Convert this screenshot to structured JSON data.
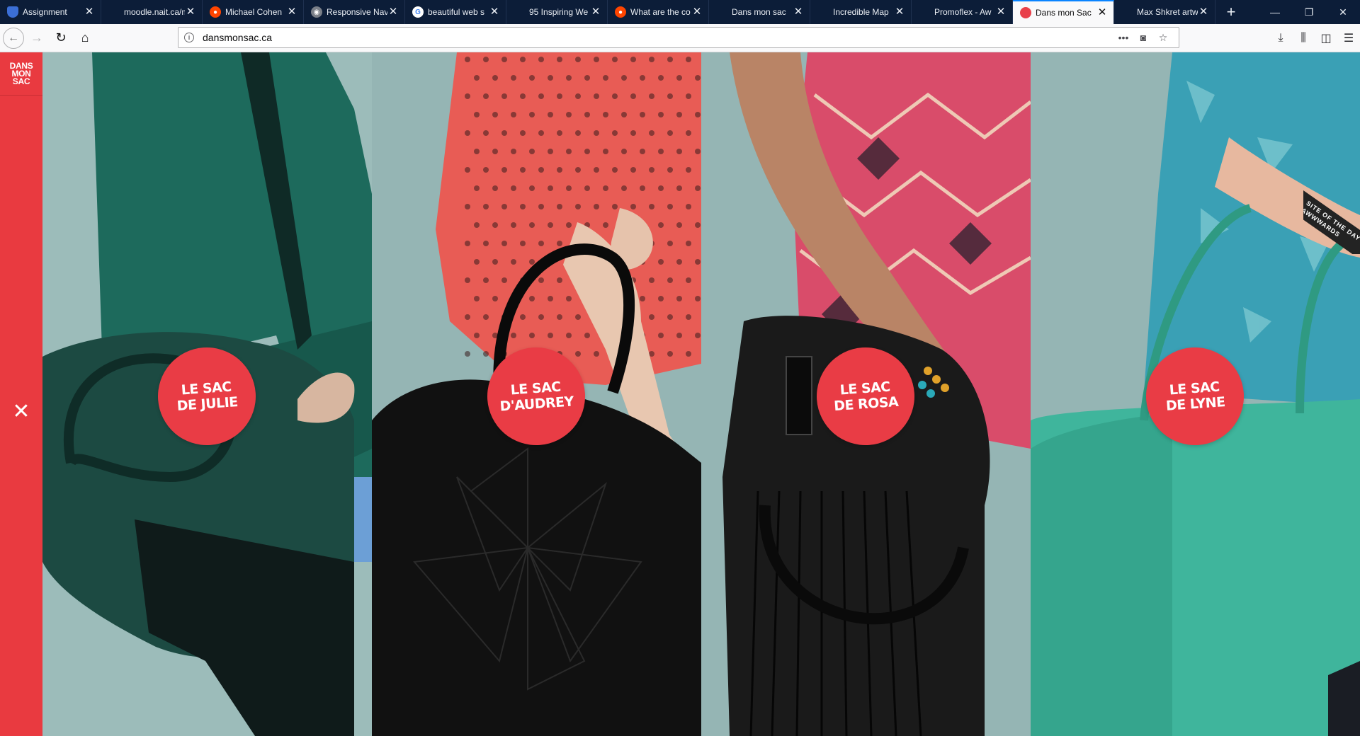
{
  "browser": {
    "tabs": [
      {
        "title": "Assignment",
        "favicon": "shield-icon",
        "fav_class": "shield",
        "active": false
      },
      {
        "title": "moodle.nait.ca/mo",
        "favicon": "none",
        "fav_class": "none",
        "active": false
      },
      {
        "title": "Michael Cohen",
        "favicon": "reddit-icon",
        "fav_class": "reddit",
        "active": false
      },
      {
        "title": "Responsive Nav",
        "favicon": "owl-icon",
        "fav_class": "owl",
        "active": false
      },
      {
        "title": "beautiful web s",
        "favicon": "google-icon",
        "fav_class": "google",
        "active": false
      },
      {
        "title": "95 Inspiring We",
        "favicon": "none",
        "fav_class": "none",
        "active": false
      },
      {
        "title": "What are the co",
        "favicon": "reddit-icon",
        "fav_class": "reddit",
        "active": false
      },
      {
        "title": "Dans mon sac",
        "favicon": "none",
        "fav_class": "none",
        "active": false
      },
      {
        "title": "Incredible Map",
        "favicon": "none",
        "fav_class": "none",
        "active": false
      },
      {
        "title": "Promoflex - Aw",
        "favicon": "none",
        "fav_class": "none",
        "active": false
      },
      {
        "title": "Dans mon Sac",
        "favicon": "bag-icon",
        "fav_class": "pink",
        "active": true
      },
      {
        "title": "Max Shkret artw",
        "favicon": "none",
        "fav_class": "none",
        "active": false
      }
    ],
    "url": "dansmonsac.ca"
  },
  "site": {
    "logo_lines": [
      "DANS",
      "MON",
      "SAC"
    ],
    "close_glyph": "✕",
    "accent": "#e93a40",
    "background": "#95b5b4",
    "ribbon": {
      "line1": "SITE OF THE DAY",
      "line2": "AWWWARDS"
    },
    "panels": [
      {
        "badge_line1": "LE SAC",
        "badge_line2": "DE JULIE",
        "top_color": "#1d6a5c",
        "bag_color": "#1c4a42"
      },
      {
        "badge_line1": "LE SAC",
        "badge_line2": "D'AUDREY",
        "top_color": "#e85c55",
        "bag_color": "#111111"
      },
      {
        "badge_line1": "LE SAC",
        "badge_line2": "DE ROSA",
        "top_color": "#d94c6a",
        "bag_color": "#1a1a1a"
      },
      {
        "badge_line1": "LE SAC",
        "badge_line2": "DE LYNE",
        "top_color": "#3aa0b5",
        "bag_color": "#3fb59c"
      }
    ]
  }
}
